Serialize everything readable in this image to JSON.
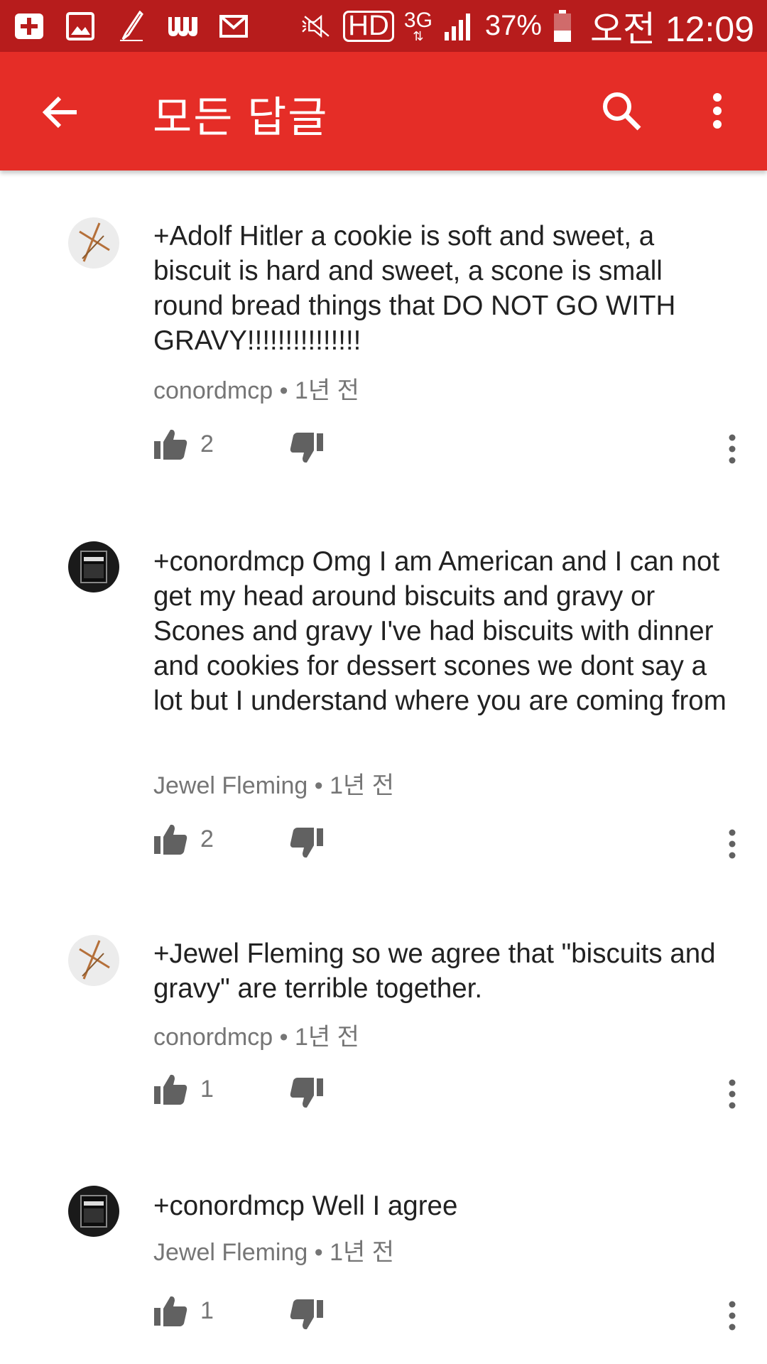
{
  "status_bar": {
    "network": "3G",
    "hd": "HD",
    "battery": "37%",
    "time": "오전 12:09",
    "icons": [
      "add-box-icon",
      "image-icon",
      "pen-icon",
      "w-app-icon",
      "mail-icon",
      "mute-icon",
      "hd-icon",
      "3g-icon",
      "signal-icon",
      "battery-icon"
    ]
  },
  "app_bar": {
    "title": "모든 답글",
    "back_icon": "arrow-back-icon",
    "search_icon": "search-icon",
    "more_icon": "more-vert-icon",
    "color": "#e52d27"
  },
  "comments": [
    {
      "text": "+Adolf Hitler a cookie is soft and sweet, a biscuit is hard and sweet, a scone is small round bread things that DO NOT GO WITH GRAVY!!!!!!!!!!!!!!!",
      "author": "conordmcp",
      "separator": "•",
      "time": "1년 전",
      "likes": "2"
    },
    {
      "text": "+conordmcp Omg I am American and I can not get my head around biscuits and gravy or Scones and gravy I've had biscuits with dinner and cookies for dessert scones we dont say a lot but I understand where you are coming from",
      "author": "Jewel Fleming",
      "separator": "•",
      "time": "1년 전",
      "likes": "2"
    },
    {
      "text": "+Jewel Fleming so we agree that \"biscuits and gravy\" are terrible together.",
      "author": "conordmcp",
      "separator": "•",
      "time": "1년 전",
      "likes": "1"
    },
    {
      "text": "+conordmcp Well I agree",
      "author": "Jewel Fleming",
      "separator": "•",
      "time": "1년 전",
      "likes": "1"
    }
  ]
}
